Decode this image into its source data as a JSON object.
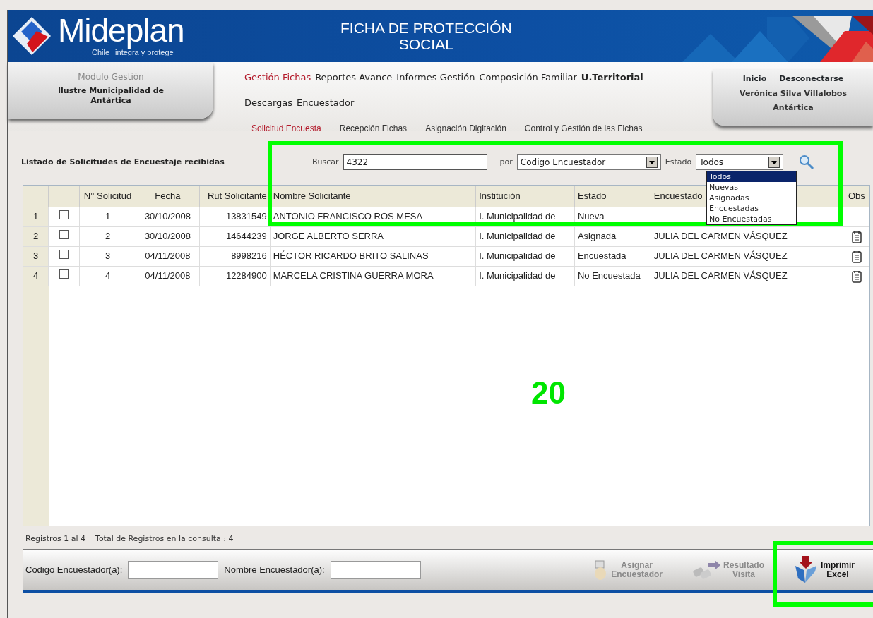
{
  "header": {
    "logo": "Mideplan",
    "tagline_1": "Chile",
    "tagline_2": "integra y protege",
    "title_1": "FICHA DE PROTECCIÓN",
    "title_2": "SOCIAL"
  },
  "left_panel": {
    "module": "Módulo Gestión",
    "municipality": "Ilustre Municipalidad de Antártica"
  },
  "main_menu": [
    {
      "label": "Gestión Fichas",
      "selected": true
    },
    {
      "label": "Reportes Avance",
      "selected": false
    },
    {
      "label": "Informes Gestión",
      "selected": false
    },
    {
      "label": "Composición Familiar",
      "selected": false
    },
    {
      "label": "U.Territorial",
      "selected": false
    },
    {
      "label": "Descargas",
      "selected": false
    },
    {
      "label": "Encuestador",
      "selected": false
    }
  ],
  "sub_menu": [
    {
      "label": "Solicitud Encuesta",
      "selected": true
    },
    {
      "label": "Recepción Fichas",
      "selected": false
    },
    {
      "label": "Asignación Digitación",
      "selected": false
    },
    {
      "label": "Control y Gestión de las Fichas",
      "selected": false
    }
  ],
  "user_panel": {
    "links": [
      "Inicio",
      "Desconectarse"
    ],
    "user": "Verónica Silva Villalobos",
    "commune": "Antártica"
  },
  "list_title": "Listado de Solicitudes de Encuestaje recibidas",
  "search": {
    "label": "Buscar",
    "value": "4322",
    "by_label": "por",
    "by_value": "Codigo Encuestador",
    "state_label": "Estado",
    "state_value": "Todos",
    "state_options": [
      {
        "label": "Todos",
        "selected": true
      },
      {
        "label": "Nuevas",
        "selected": false
      },
      {
        "label": "Asignadas",
        "selected": false
      },
      {
        "label": "Encuestadas",
        "selected": false
      },
      {
        "label": "No Encuestadas",
        "selected": false
      }
    ]
  },
  "table": {
    "columns": [
      "N° Solicitud",
      "Fecha",
      "Rut Solicitante",
      "Nombre Solicitante",
      "Institución",
      "Estado",
      "Encuestado",
      "Obs"
    ],
    "rows": [
      {
        "index": "1",
        "checked": false,
        "number": "1",
        "date": "30/10/2008",
        "rut": "13831549",
        "name": "ANTONIO FRANCISCO ROS MESA",
        "institution": "I. Municipalidad de",
        "state": "Nueva",
        "surveyor": "",
        "has_obs": false
      },
      {
        "index": "2",
        "checked": false,
        "number": "2",
        "date": "30/10/2008",
        "rut": "14644239",
        "name": "JORGE ALBERTO SERRA",
        "institution": "I. Municipalidad de",
        "state": "Asignada",
        "surveyor": "JULIA DEL CARMEN VÁSQUEZ",
        "has_obs": true
      },
      {
        "index": "3",
        "checked": false,
        "number": "3",
        "date": "04/11/2008",
        "rut": "8998216",
        "name": "HÉCTOR RICARDO BRITO SALINAS",
        "institution": "I. Municipalidad de",
        "state": "Encuestada",
        "surveyor": "JULIA DEL CARMEN VÁSQUEZ",
        "has_obs": true
      },
      {
        "index": "4",
        "checked": false,
        "number": "4",
        "date": "04/11/2008",
        "rut": "12284900",
        "name": "MARCELA CRISTINA GUERRA MORA",
        "institution": "I. Municipalidad de",
        "state": "No Encuestada",
        "surveyor": "JULIA DEL CARMEN VÁSQUEZ",
        "has_obs": true
      }
    ]
  },
  "records": {
    "range": "Registros 1 al 4",
    "total": "Total de Registros en la consulta : 4"
  },
  "bottom_bar": {
    "fields": [
      {
        "label": "Codigo Encuestador(a):"
      },
      {
        "label": "Nombre Encuestador(a):"
      }
    ],
    "actions": [
      {
        "kind": "assign",
        "line_1": "Asignar",
        "line_2": "Encuestador",
        "disabled": true
      },
      {
        "kind": "result",
        "line_1": "Resultado",
        "line_2": "Visita",
        "disabled": true
      },
      {
        "kind": "excel",
        "line_1": "Imprimir",
        "line_2": "Excel",
        "disabled": false
      }
    ]
  },
  "annotation": {
    "label": "20"
  }
}
